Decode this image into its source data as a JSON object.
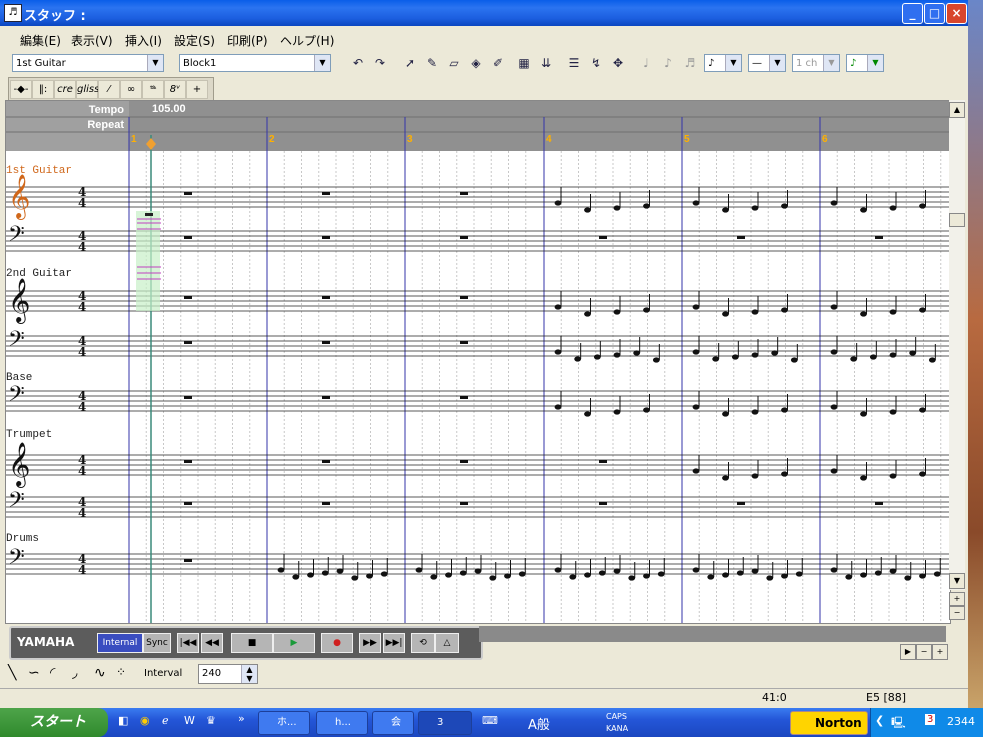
{
  "window": {
    "title": "スタッフ :"
  },
  "menu": [
    "編集(E)",
    "表示(V)",
    "挿入(I)",
    "設定(S)",
    "印刷(P)",
    "ヘルプ(H)"
  ],
  "toolbar": {
    "part_select": "1st Guitar",
    "block_select": "Block1",
    "channel_select": "1 ch"
  },
  "ruler": {
    "tempo_label": "Tempo",
    "repeat_label": "Repeat",
    "tempo_value": "105.00",
    "measures": [
      "1",
      "2",
      "3",
      "4",
      "5",
      "6"
    ]
  },
  "parts": [
    {
      "name": "1st Guitar"
    },
    {
      "name": "2nd Guitar"
    },
    {
      "name": "Base"
    },
    {
      "name": "Trumpet"
    },
    {
      "name": "Drums"
    }
  ],
  "time_signature": {
    "top": "4",
    "bottom": "4"
  },
  "transport": {
    "brand": "YAMAHA",
    "internal": "Internal",
    "sync": "Sync"
  },
  "edit_bar": {
    "interval_label": "Interval",
    "interval_value": "240"
  },
  "status": {
    "position": "41:0",
    "note": "E5 [88]"
  },
  "taskbar": {
    "start": "スタート",
    "tasks": [
      "ホ...",
      "h...",
      "会",
      "3"
    ],
    "ime": "A般",
    "caps": "CAPS",
    "kana": "KANA",
    "norton": "Norton",
    "tray_badge": "3",
    "clock": "2344"
  },
  "colors": {
    "measure_line": "#3333aa",
    "cursor": "#f0a030",
    "accent": "#ff8800"
  }
}
